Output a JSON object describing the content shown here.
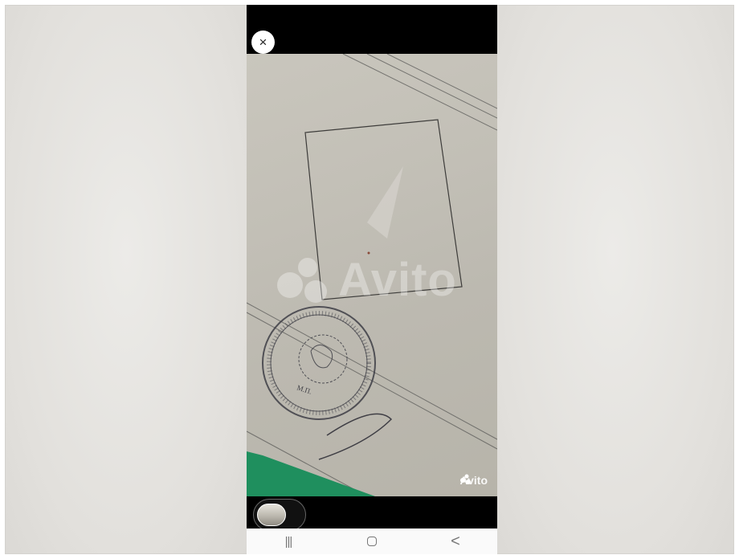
{
  "viewer": {
    "close_icon": "×",
    "watermark": "Avito",
    "corner_watermark": "Avito",
    "stamp_text": "М.П."
  },
  "navbar": {
    "recent_icon": "|||",
    "home_icon": "home-icon",
    "back_icon": "<"
  }
}
